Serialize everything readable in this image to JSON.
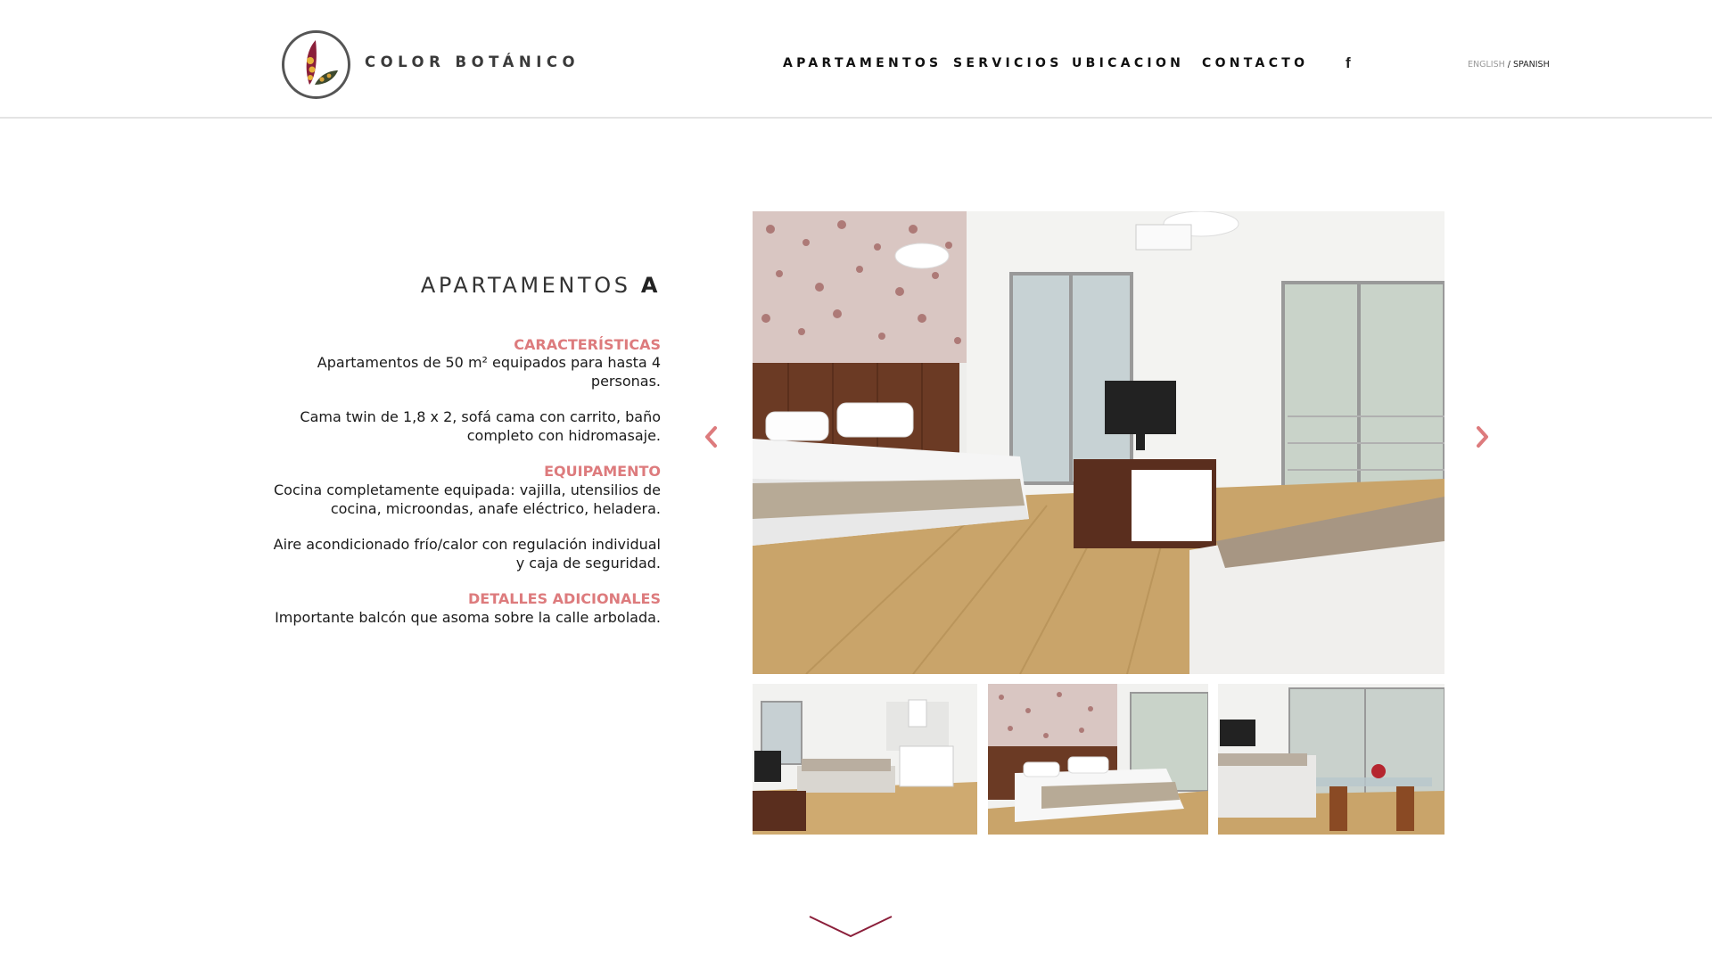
{
  "header": {
    "brand": "COLOR BOTÁNICO",
    "nav": [
      "APARTAMENTOS",
      "SERVICIOS",
      "UBICACION",
      "CONTACTO"
    ],
    "social_icon": "facebook-icon",
    "social_glyph": "f",
    "lang": {
      "english": "ENGLISH",
      "separator": " / ",
      "spanish": "SPANISH"
    }
  },
  "content": {
    "title_main": "APARTAMENTOS",
    "title_letter": "A",
    "sections": [
      {
        "heading": "CARACTERÍSTICAS",
        "paragraphs": [
          "Apartamentos de 50 m² equipados para hasta 4 personas.",
          "Cama twin de 1,8 x 2, sofá cama con carrito, baño completo con hidromasaje."
        ]
      },
      {
        "heading": "EQUIPAMENTO",
        "paragraphs": [
          "Cocina completamente equipada: vajilla, utensilios de cocina, microondas, anafe eléctrico, heladera.",
          "Aire acondicionado frío/calor con regulación individual y caja de seguridad."
        ]
      },
      {
        "heading": "DETALLES ADICIONALES",
        "paragraphs": [
          "Importante balcón que asoma sobre la calle arbolada."
        ]
      }
    ]
  },
  "gallery": {
    "prev_icon": "chevron-left-icon",
    "next_icon": "chevron-right-icon",
    "scroll_icon": "chevron-down-icon"
  },
  "colors": {
    "accent": "#dd7b7d",
    "brand_dark": "#8b1f3a",
    "text": "#1a1a1a",
    "divider": "#e4e4e4"
  }
}
